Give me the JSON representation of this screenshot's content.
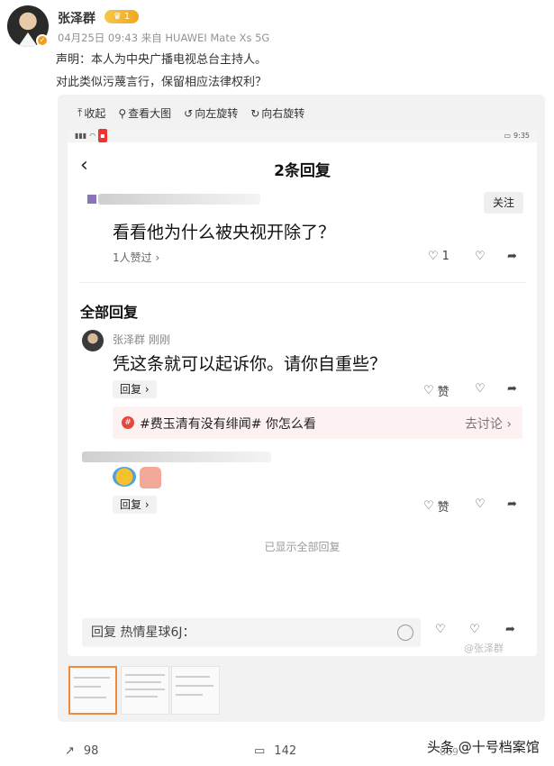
{
  "post": {
    "username": "张泽群",
    "vip_label": "1",
    "meta": "04月25日 09:43  来自 HUAWEI Mate Xs 5G",
    "line1": "声明：本人为中央广播电视总台主持人。",
    "line2": "对此类似污蔑言行，保留相应法律权利？"
  },
  "toolbar": {
    "collapse": "收起",
    "view_large": "查看大图",
    "rotate_left": "向左旋转",
    "rotate_right": "向右旋转"
  },
  "screenshot": {
    "status_time": "9:35",
    "title": "2条回复",
    "follow": "关注",
    "question": "看看他为什么被央视开除了？",
    "likes_text": "1人赞过 ›",
    "like_count": "1",
    "all_replies": "全部回复",
    "reply_name": "张泽群  刚刚",
    "reply_text": "凭这条就可以起诉你。请你自重些？",
    "reply_btn": "回复 ›",
    "like_label": "赞",
    "topic_text": "#费玉清有没有绯闻# 你怎么看",
    "topic_link": "去讨论 ›",
    "end_text": "已显示全部回复",
    "input_placeholder": "回复 热情星球6J：",
    "watermark": "@张泽群"
  },
  "footer": {
    "reposts": "98",
    "comments": "142",
    "likes": "869",
    "brand": "头条 @十号档案馆"
  },
  "colors": {
    "accent_orange": "#f08b3c",
    "topic_red": "#e8463b",
    "vip_gold": "#f0a81c"
  }
}
